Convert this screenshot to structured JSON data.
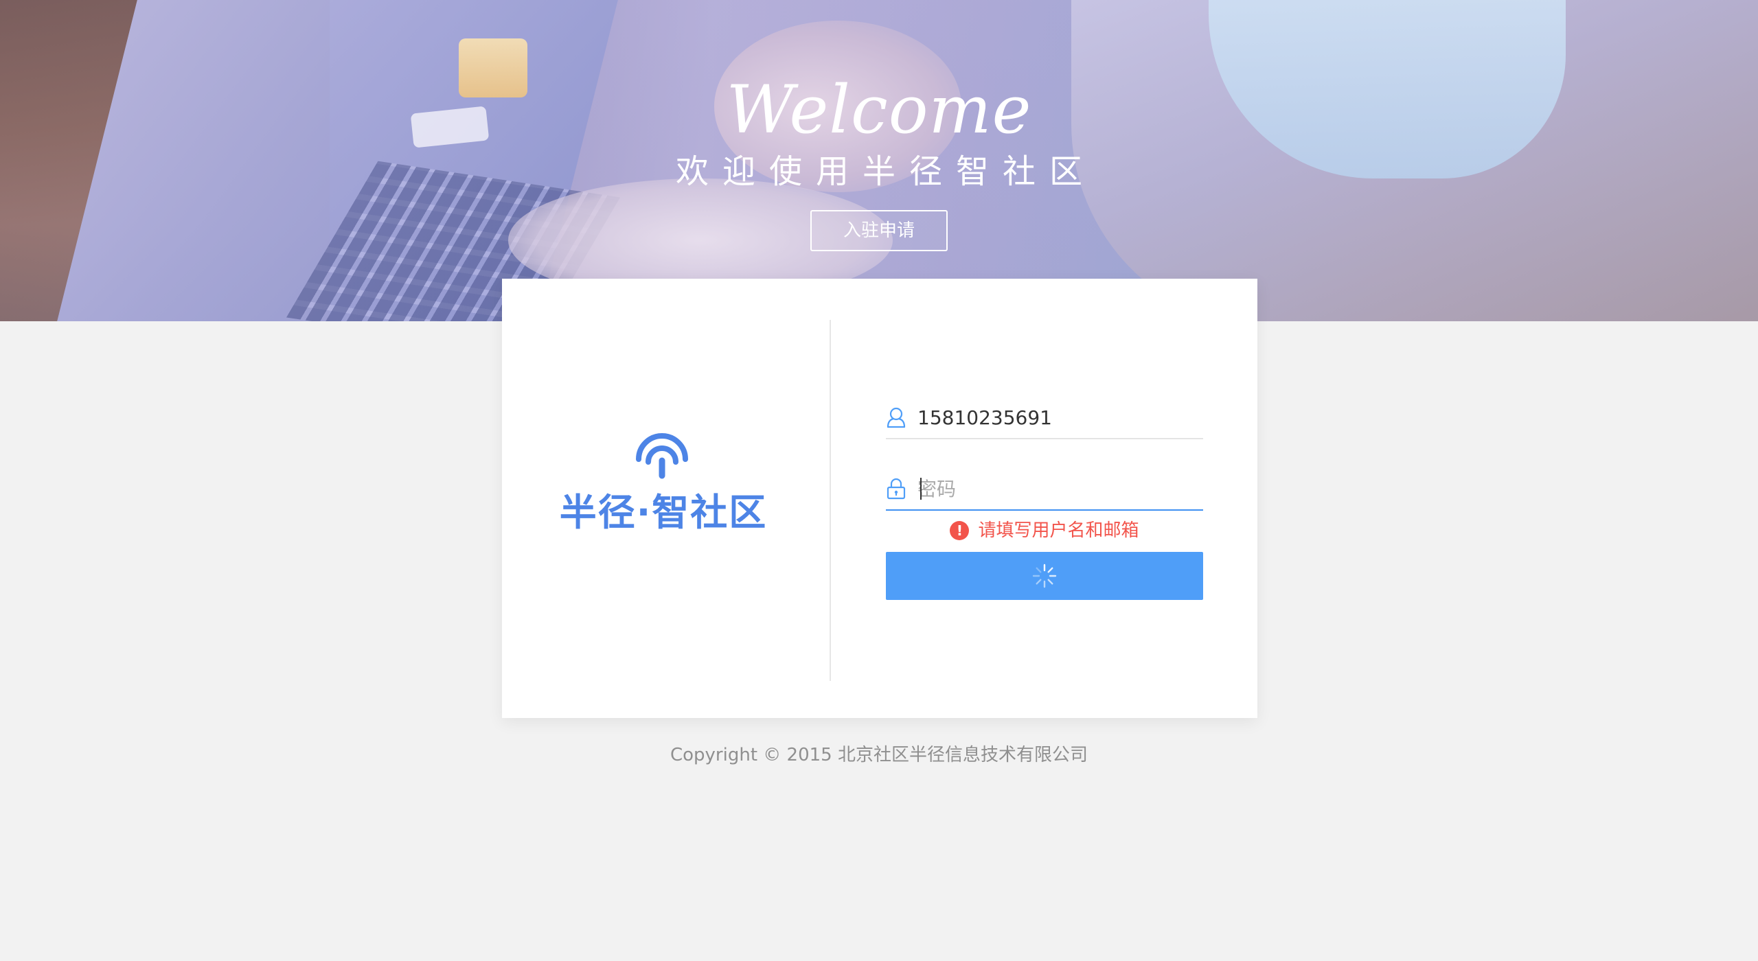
{
  "hero": {
    "title": "Welcome",
    "subtitle": "欢迎使用半径智社区",
    "apply_button_label": "入驻申请"
  },
  "logo": {
    "text": "半径·智社区",
    "icon": "signal-arch-icon",
    "color": "#4d84e6"
  },
  "login_form": {
    "username": {
      "icon": "user-icon",
      "value": "15810235691"
    },
    "password": {
      "icon": "lock-icon",
      "value": "",
      "placeholder": "密码"
    },
    "error": {
      "icon": "error-icon",
      "message": "请填写用户名和邮箱",
      "color": "#f2544b"
    },
    "submit": {
      "state": "loading",
      "icon": "spinner-icon",
      "color": "#4f9ef8"
    }
  },
  "footer": {
    "copyright": "Copyright © 2015 北京社区半径信息技术有限公司"
  }
}
